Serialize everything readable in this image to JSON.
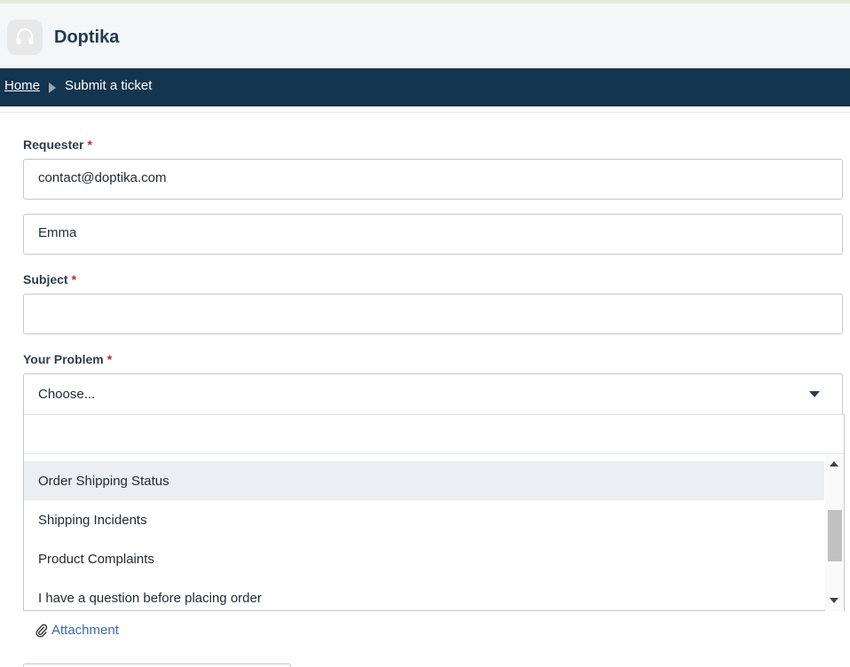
{
  "header": {
    "brand": "Doptika",
    "logo_icon": "headset-icon"
  },
  "breadcrumb": {
    "home": "Home",
    "current": "Submit a ticket",
    "separator_icon": "chevron-right-icon"
  },
  "form": {
    "requester": {
      "label": "Requester",
      "required_mark": "*",
      "email_value": "contact@doptika.com",
      "name_value": "Emma"
    },
    "subject": {
      "label": "Subject",
      "required_mark": "*",
      "value": ""
    },
    "problem": {
      "label": "Your Problem",
      "required_mark": "*",
      "selected": "Choose...",
      "options": [
        "Order Shipping Status",
        "Shipping Incidents",
        "Product Complaints",
        "I have a question before placing order"
      ]
    },
    "attachment": {
      "label": "Attachment",
      "icon": "paperclip-icon"
    }
  },
  "colors": {
    "navbar": "#14354f",
    "header_bg": "#f4f6f8",
    "required": "#c0262b",
    "link": "#3a69b0",
    "highlight": "#ebeef2"
  }
}
